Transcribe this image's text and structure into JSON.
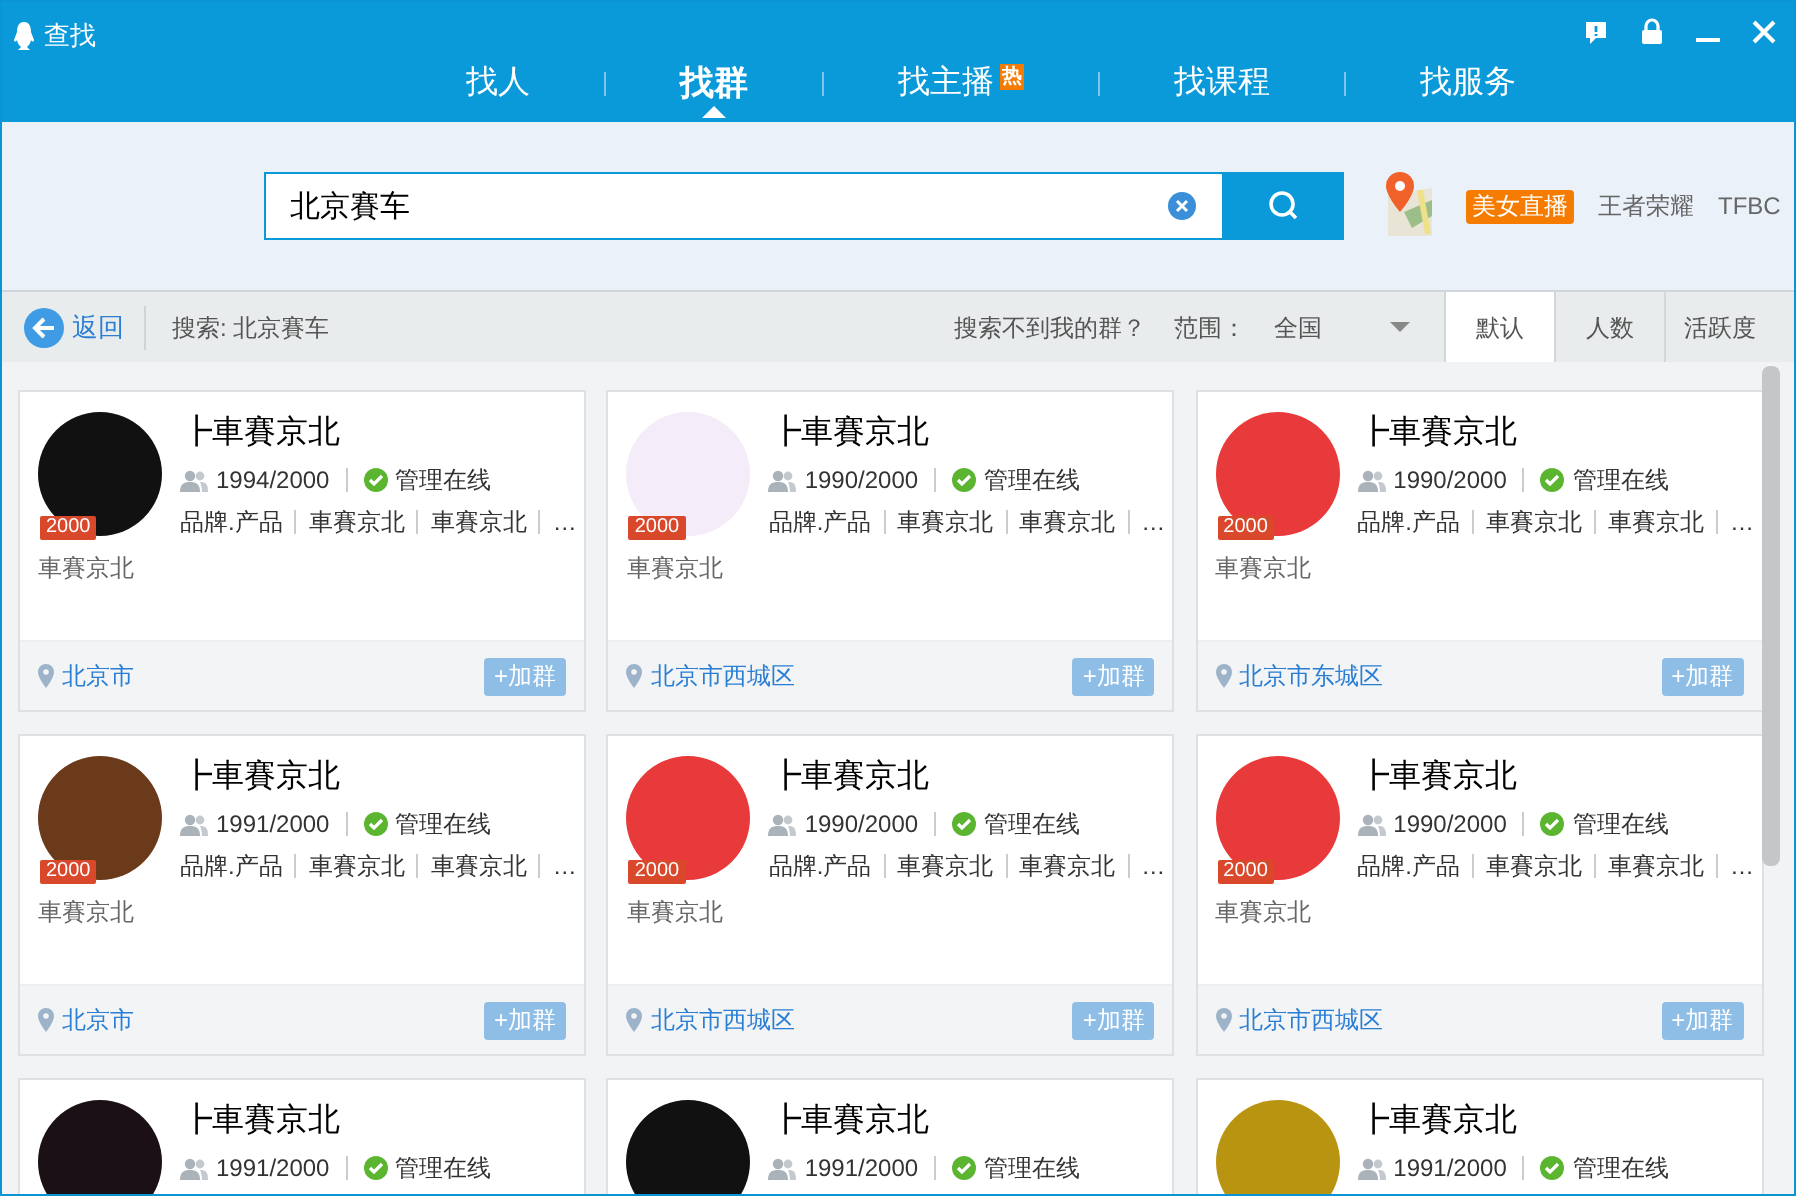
{
  "window": {
    "title": "查找"
  },
  "tabs": [
    {
      "label": "找人",
      "selected": false,
      "hot": false
    },
    {
      "label": "找群",
      "selected": true,
      "hot": false
    },
    {
      "label": "找主播",
      "selected": false,
      "hot": true,
      "badge": "热"
    },
    {
      "label": "找课程",
      "selected": false,
      "hot": false
    },
    {
      "label": "找服务",
      "selected": false,
      "hot": false
    }
  ],
  "search": {
    "value": "北京賽车"
  },
  "hot_tags": [
    {
      "label": "美女直播",
      "highlighted": true
    },
    {
      "label": "王者荣耀",
      "highlighted": false
    },
    {
      "label": "TFBC",
      "highlighted": false
    }
  ],
  "filter_bar": {
    "back": "返回",
    "query": "搜索: 北京賽车",
    "help": "搜索不到我的群？",
    "range_label": "范围：",
    "range_value": "全国",
    "sorts": [
      {
        "label": "默认",
        "selected": true
      },
      {
        "label": "人数",
        "selected": false
      },
      {
        "label": "活跃度",
        "selected": false
      }
    ]
  },
  "groups": [
    {
      "name": "┣車賽京北",
      "badge": "2000",
      "members": "1994/2000",
      "admin": "管理在线",
      "admin_online": true,
      "tags": [
        "品牌.产品",
        "車賽京北",
        "車賽京北",
        "…"
      ],
      "description": "車賽京北",
      "location": "北京市",
      "join": "+加群"
    },
    {
      "name": "┣車賽京北",
      "badge": "2000",
      "members": "1990/2000",
      "admin": "管理在线",
      "admin_online": true,
      "tags": [
        "品牌.产品",
        "車賽京北",
        "車賽京北",
        "…"
      ],
      "description": "車賽京北",
      "location": "北京市西城区",
      "join": "+加群"
    },
    {
      "name": "┣車賽京北",
      "badge": "2000",
      "members": "1990/2000",
      "admin": "管理在线",
      "admin_online": true,
      "tags": [
        "品牌.产品",
        "車賽京北",
        "車賽京北",
        "…"
      ],
      "description": "車賽京北",
      "location": "北京市东城区",
      "join": "+加群"
    },
    {
      "name": "┣車賽京北",
      "badge": "2000",
      "members": "1991/2000",
      "admin": "管理在线",
      "admin_online": true,
      "tags": [
        "品牌.产品",
        "車賽京北",
        "車賽京北",
        "…"
      ],
      "description": "車賽京北",
      "location": "北京市",
      "join": "+加群"
    },
    {
      "name": "┣車賽京北",
      "badge": "2000",
      "members": "1990/2000",
      "admin": "管理在线",
      "admin_online": true,
      "tags": [
        "品牌.产品",
        "車賽京北",
        "車賽京北",
        "…"
      ],
      "description": "車賽京北",
      "location": "北京市西城区",
      "join": "+加群"
    },
    {
      "name": "┣車賽京北",
      "badge": "2000",
      "members": "1990/2000",
      "admin": "管理在线",
      "admin_online": true,
      "tags": [
        "品牌.产品",
        "車賽京北",
        "車賽京北",
        "…"
      ],
      "description": "車賽京北",
      "location": "北京市西城区",
      "join": "+加群"
    },
    {
      "name": "┣車賽京北",
      "members": "1991/2000",
      "admin": "管理在线",
      "admin_online": true
    },
    {
      "name": "┣車賽京北",
      "members": "1991/2000",
      "admin": "管理在线",
      "admin_online": true
    },
    {
      "name": "┣車賽京北",
      "members": "1991/2000",
      "admin": "管理在线",
      "admin_online": true
    }
  ]
}
